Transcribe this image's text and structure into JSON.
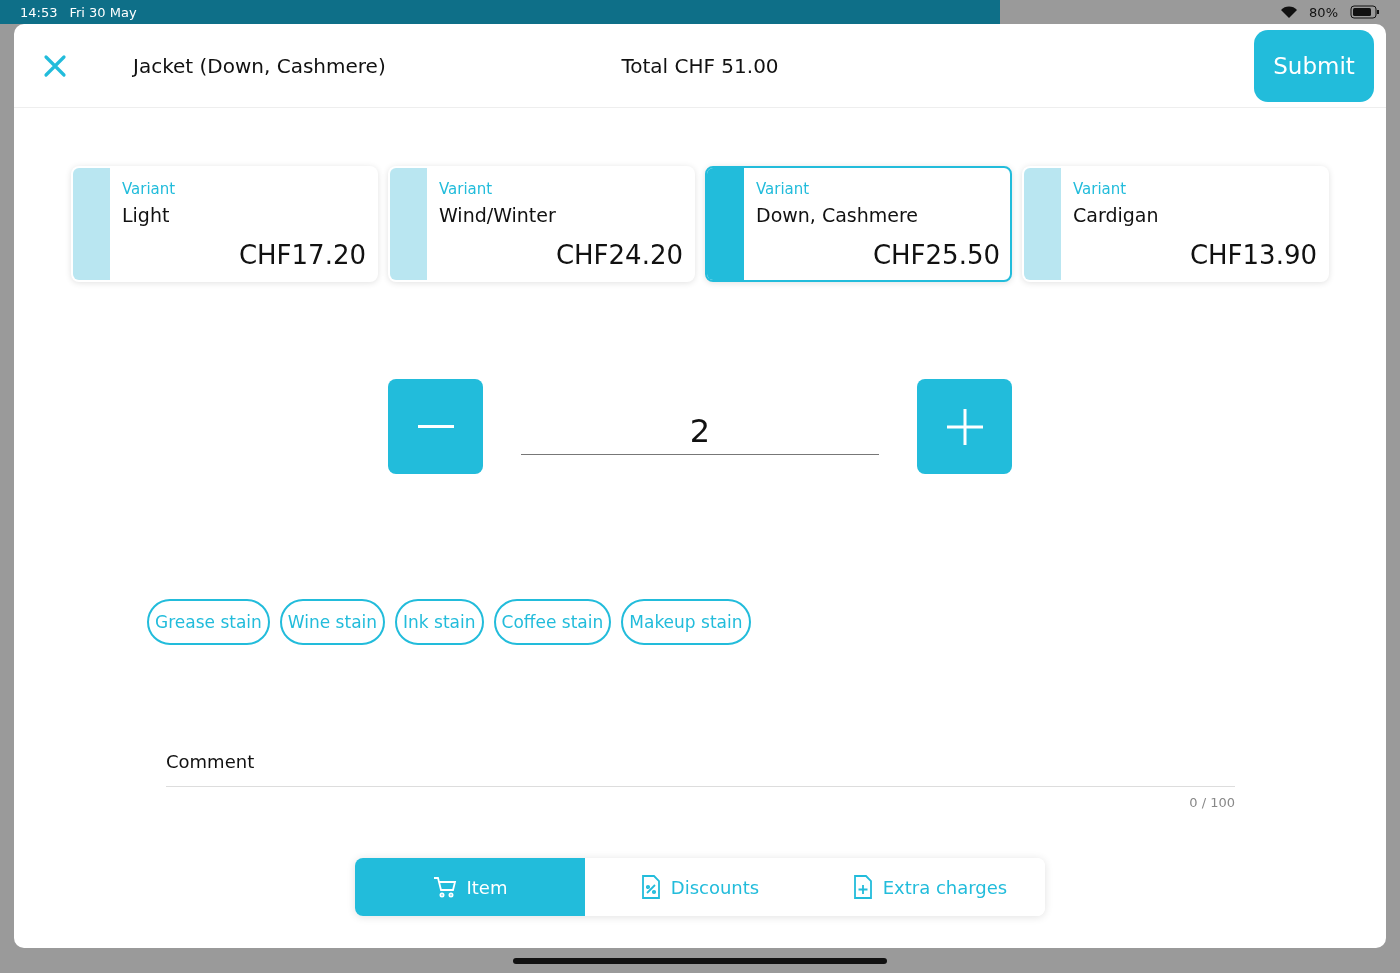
{
  "status_bar": {
    "time": "14:53",
    "date": "Fri 30 May",
    "battery": "80%"
  },
  "header": {
    "title": "Jacket (Down, Cashmere)",
    "total": "Total CHF 51.00",
    "submit": "Submit"
  },
  "variants": [
    {
      "label": "Variant",
      "name": "Light",
      "price": "CHF17.20",
      "selected": false
    },
    {
      "label": "Variant",
      "name": "Wind/Winter",
      "price": "CHF24.20",
      "selected": false
    },
    {
      "label": "Variant",
      "name": "Down, Cashmere",
      "price": "CHF25.50",
      "selected": true
    },
    {
      "label": "Variant",
      "name": "Cardigan",
      "price": "CHF13.90",
      "selected": false
    }
  ],
  "quantity": {
    "value": "2"
  },
  "stains": [
    "Grease stain",
    "Wine stain",
    "Ink stain",
    "Coffee stain",
    "Makeup stain"
  ],
  "comment": {
    "label": "Comment",
    "counter": "0 / 100"
  },
  "tabs": [
    {
      "kind": "cart",
      "label": "Item",
      "selected": true
    },
    {
      "kind": "discount",
      "label": "Discounts",
      "selected": false
    },
    {
      "kind": "extra",
      "label": "Extra charges",
      "selected": false
    }
  ]
}
